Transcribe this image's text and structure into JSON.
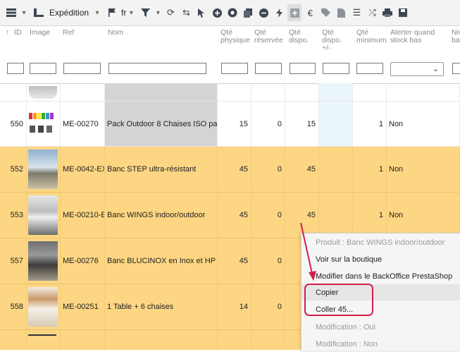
{
  "toolbar": {
    "expedition_label": "Expédition",
    "lang_label": "fr",
    "icons": [
      "list-icon",
      "truck-icon",
      "flag-icon",
      "filter-icon",
      "refresh-icon",
      "sync-icon",
      "pointer-icon",
      "plus-circle-icon",
      "chrome-icon",
      "copy-icon",
      "minus-circle-icon",
      "lightning-icon",
      "add-square-icon",
      "euro-icon",
      "tag-icon",
      "csv-icon",
      "list-ordered-icon",
      "shuffle-icon",
      "print-icon",
      "save-icon"
    ]
  },
  "columns": {
    "id": "ID",
    "image": "Image",
    "ref": "Ref",
    "nom": "Nom",
    "qte_physique": "Qté physique",
    "qte_reservee": "Qté réservée",
    "qte_dispo": "Qté dispo.",
    "qte_dispo_pm": "Qté dispo. +/-",
    "qte_minimum": "Qté minimum",
    "alerter": "Alerter quand stock bas",
    "next": "Niv ba"
  },
  "rows": [
    {
      "id": "550",
      "ref": "ME-00270",
      "nom": "Pack Outdoor 8 Chaises ISO pa",
      "physique": "15",
      "reservee": "0",
      "dispo": "15",
      "minimum": "1",
      "alerter": "Non"
    },
    {
      "id": "552",
      "ref": "ME-0042-EX",
      "nom": "Banc STEP ultra-résistant",
      "physique": "45",
      "reservee": "0",
      "dispo": "45",
      "minimum": "1",
      "alerter": "Non"
    },
    {
      "id": "553",
      "ref": "ME-00210-E",
      "nom": "Banc WINGS indoor/outdoor",
      "physique": "45",
      "reservee": "0",
      "dispo": "45",
      "minimum": "1",
      "alerter": "Non"
    },
    {
      "id": "557",
      "ref": "ME-00276",
      "nom": "Banc BLUCINOX en Inox et HP",
      "physique": "45",
      "reservee": "0",
      "dispo": "",
      "minimum": "",
      "alerter": ""
    },
    {
      "id": "558",
      "ref": "ME-00251",
      "nom": "1 Table + 6 chaises",
      "physique": "14",
      "reservee": "0",
      "dispo": "",
      "minimum": "",
      "alerter": ""
    }
  ],
  "context_menu": {
    "title": "Produit : Banc WINGS indoor/outdoor",
    "view_shop": "Voir sur la boutique",
    "edit_backoffice": "Modifier dans le BackOffice PrestaShop",
    "copy": "Copier",
    "paste": "Coller 45...",
    "modif_oui": "Modification : Oui",
    "modif_non": "Modification : Non"
  },
  "colors": {
    "row_highlight": "#fdd683",
    "annotation": "#d11f4a"
  }
}
